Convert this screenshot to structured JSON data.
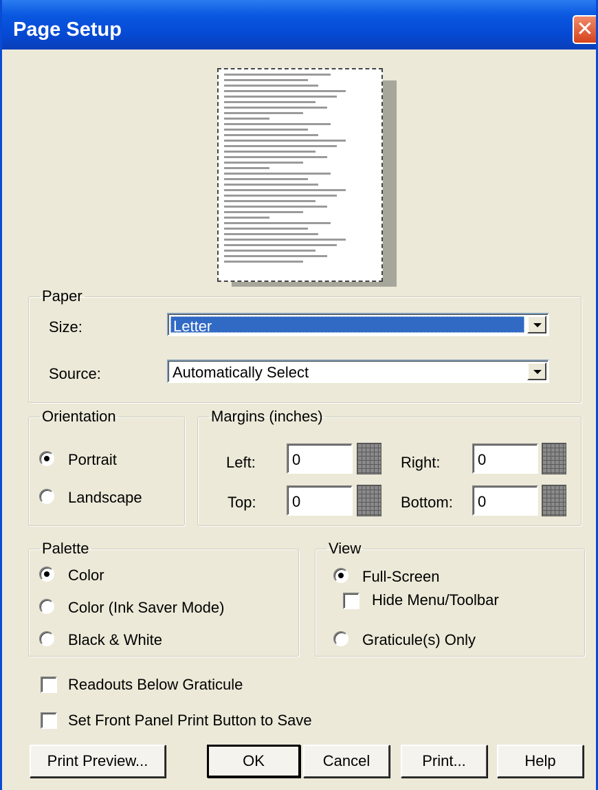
{
  "window": {
    "title": "Page Setup",
    "close_glyph": "✕"
  },
  "paper": {
    "legend": "Paper",
    "size_label": "Size:",
    "size_value": "Letter",
    "source_label": "Source:",
    "source_value": "Automatically Select"
  },
  "orientation": {
    "legend": "Orientation",
    "portrait_label": "Portrait",
    "landscape_label": "Landscape",
    "selected": "Portrait"
  },
  "margins": {
    "legend": "Margins (inches)",
    "left_label": "Left:",
    "left_value": "0",
    "right_label": "Right:",
    "right_value": "0",
    "top_label": "Top:",
    "top_value": "0",
    "bottom_label": "Bottom:",
    "bottom_value": "0"
  },
  "palette": {
    "legend": "Palette",
    "color_label": "Color",
    "ink_saver_label": "Color (Ink Saver Mode)",
    "bw_label": "Black & White",
    "selected": "Color"
  },
  "view": {
    "legend": "View",
    "full_screen_label": "Full-Screen",
    "hide_menu_label": "Hide Menu/Toolbar",
    "graticule_only_label": "Graticule(s) Only",
    "selected": "Full-Screen",
    "hide_menu_checked": false
  },
  "options": {
    "readouts_label": "Readouts Below Graticule",
    "readouts_checked": false,
    "set_front_panel_label": "Set Front Panel Print Button to Save",
    "set_front_panel_checked": false
  },
  "buttons": {
    "print_preview": "Print Preview...",
    "ok": "OK",
    "cancel": "Cancel",
    "print": "Print...",
    "help": "Help"
  },
  "colors": {
    "title_bar": "#0549d3",
    "dialog_bg": "#ece9d8",
    "selection": "#316ac5",
    "close_button": "#d6421c"
  },
  "icons": {
    "close": "close-icon",
    "dropdown": "chevron-down-icon",
    "spinner": "spinner-grid-icon"
  }
}
